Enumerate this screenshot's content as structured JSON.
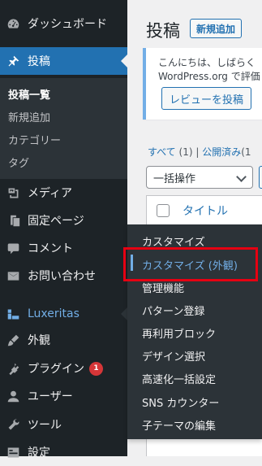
{
  "sidebar": {
    "items": [
      {
        "icon": "dashboard-icon",
        "label": "ダッシュボード"
      },
      {
        "icon": "pin-icon",
        "label": "投稿"
      },
      {
        "icon": "media-icon",
        "label": "メディア"
      },
      {
        "icon": "page-icon",
        "label": "固定ページ"
      },
      {
        "icon": "comment-icon",
        "label": "コメント"
      },
      {
        "icon": "mail-icon",
        "label": "お問い合わせ"
      },
      {
        "icon": "luxeritas-icon",
        "label": "Luxeritas"
      },
      {
        "icon": "brush-icon",
        "label": "外観"
      },
      {
        "icon": "plugin-icon",
        "label": "プラグイン",
        "badge": "1"
      },
      {
        "icon": "user-icon",
        "label": "ユーザー"
      },
      {
        "icon": "wrench-icon",
        "label": "ツール"
      },
      {
        "icon": "settings-icon",
        "label": "設定"
      }
    ],
    "posts_submenu": [
      "投稿一覧",
      "新規追加",
      "カテゴリー",
      "タグ"
    ]
  },
  "main": {
    "title": "投稿",
    "add_new": "新規追加",
    "notice": {
      "line1": "こんにちは、しばらく",
      "line2": "WordPress.org で評価",
      "button": "レビューを投稿"
    },
    "views": {
      "all_label": "すべて",
      "all_count": "(1)",
      "separator": "|",
      "published_label": "公開済み",
      "published_count": "(1"
    },
    "bulk_action": "一括操作",
    "table_header_title": "タイトル"
  },
  "flyout": {
    "items": [
      "カスタマイズ",
      "カスタマイズ (外観)",
      "管理機能",
      "パターン登録",
      "再利用ブロック",
      "デザイン選択",
      "高速化一括設定",
      "SNS カウンター",
      "子テーマの編集"
    ]
  },
  "colors": {
    "sidebar_bg": "#1d2327",
    "submenu_bg": "#2c3338",
    "current_bg": "#2271b1",
    "link": "#2271b1",
    "focus_text": "#72aee6",
    "highlight": "#e60012",
    "badge": "#d63638"
  }
}
